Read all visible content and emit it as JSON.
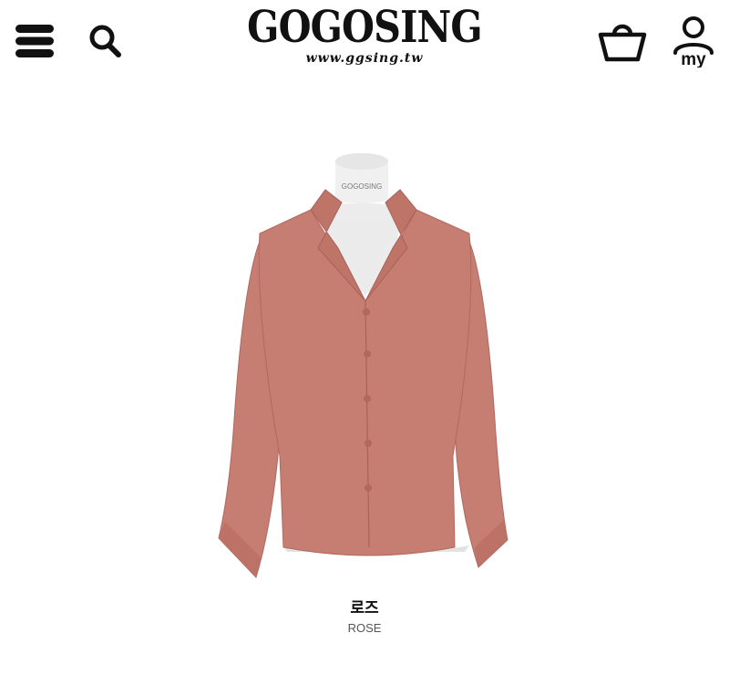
{
  "header": {
    "menu_icon": "hamburger-menu-icon",
    "search_icon": "search-icon",
    "logo": {
      "title": "GOGOSING",
      "url_text": "www.ggsing.tw"
    },
    "cart_icon": "shopping-basket-icon",
    "account": {
      "icon": "user-icon",
      "label": "my"
    }
  },
  "product": {
    "image": "blouse-on-mannequin",
    "mannequin_label": "GOGOSING",
    "color_swatch": "#c67d72",
    "color_name_ko": "로즈",
    "color_name_en": "ROSE"
  }
}
